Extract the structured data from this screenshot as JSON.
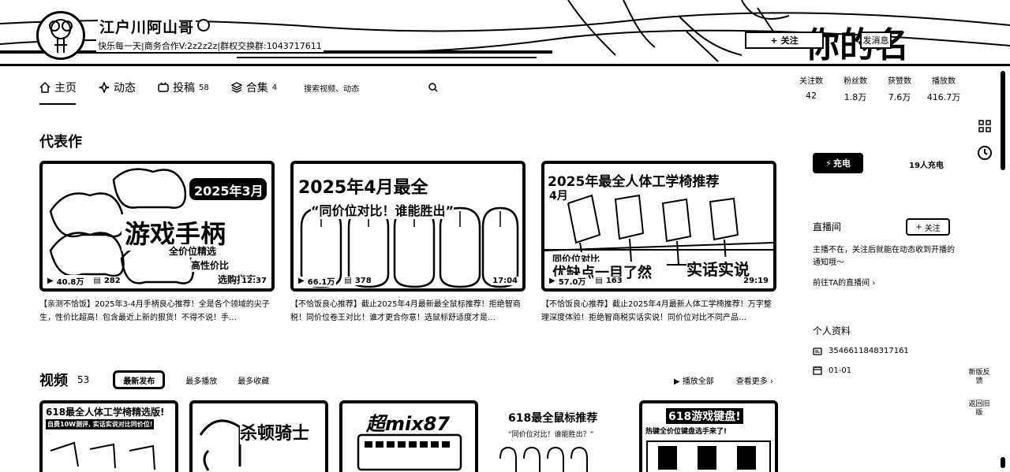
{
  "header": {
    "username": "江户川阿山哥",
    "signature": "快乐每一天|商务合作V:2z2z2z|群权交换群:1043717611",
    "follow_label": "关注",
    "message_label": "发消息"
  },
  "nav": {
    "items": [
      {
        "label": "主页",
        "count": ""
      },
      {
        "label": "动态",
        "count": ""
      },
      {
        "label": "投稿",
        "count": "58"
      },
      {
        "label": "合集",
        "count": "4"
      }
    ],
    "search_placeholder": "搜索视频、动态"
  },
  "stats": [
    {
      "label": "关注数",
      "value": "42"
    },
    {
      "label": "粉丝数",
      "value": "1.8万"
    },
    {
      "label": "获赞数",
      "value": "7.6万"
    },
    {
      "label": "播放数",
      "value": "416.7万"
    }
  ],
  "featured": {
    "title": "代表作",
    "cards": [
      {
        "thumb_title": "游戏手柄",
        "thumb_tag": "2025年3月",
        "thumb_sub1": "全价位精选",
        "thumb_sub2": "高性价比",
        "thumb_sub3": "选购指南",
        "views": "40.8万",
        "comments": "282",
        "duration": "12:37",
        "title": "【亲测不恰饭】2025年3-4月手柄良心推荐！全是各个领域的尖子生，性价比超高！包含最近上新的狠货！不得不说！手…"
      },
      {
        "thumb_title": "2025年4月最全",
        "thumb_tag": "",
        "thumb_sub1": "“同价位对比！谁能胜出”",
        "thumb_sub2": "",
        "thumb_sub3": "",
        "views": "66.1万",
        "comments": "378",
        "duration": "17:04",
        "title": "【不恰饭良心推荐】截止2025年4月最新最全鼠标推荐！拒绝智商税！同价位卷王对比！谁才更合你意！选鼠标舒适度才是…"
      },
      {
        "thumb_title": "2025年最全人体工学椅推荐",
        "thumb_tag": "4月",
        "thumb_sub1": "同价位对比",
        "thumb_sub2": "优缺点一目了然",
        "thumb_sub3": "实话实说",
        "views": "57.0万",
        "comments": "163",
        "duration": "29:19",
        "title": "【不恰饭良心推荐】截止2025年4月最新人体工学椅推荐！万字整理深度体验！拒绝智商税实话实说！同价位对比不同产品…"
      }
    ]
  },
  "videos": {
    "title": "视频",
    "count": "53",
    "tabs": [
      "最新发布",
      "最多播放",
      "最多收藏"
    ],
    "play_all": "播放全部",
    "more": "查看更多",
    "thumbs": [
      {
        "line1": "618最全人体工学椅精选版!",
        "line2": "自费10W测评, 实话实说对比同价位!"
      },
      {
        "line1": "",
        "line2": "杀顿骑士"
      },
      {
        "line1": "超mix87",
        "line2": ""
      },
      {
        "line1": "618最全鼠标推荐",
        "line2": "“同价位对比！谁能胜出？”"
      },
      {
        "line1": "618游戏键盘!",
        "line2": "热键全价位键盘选手来了!"
      }
    ]
  },
  "right": {
    "charge_label": "充电",
    "charge_count": "19人充电",
    "live_title": "直播间",
    "live_follow": "关注",
    "live_desc": "主播不在，关注后就能在动态收到开播的通知哦～",
    "live_link": "前往TA的直播间",
    "profile_title": "个人资料",
    "uid": "3546611848317161",
    "birthday": "01-01"
  },
  "sidebar_tools": {
    "feedback": "新版反馈",
    "old_version": "返回旧版"
  }
}
